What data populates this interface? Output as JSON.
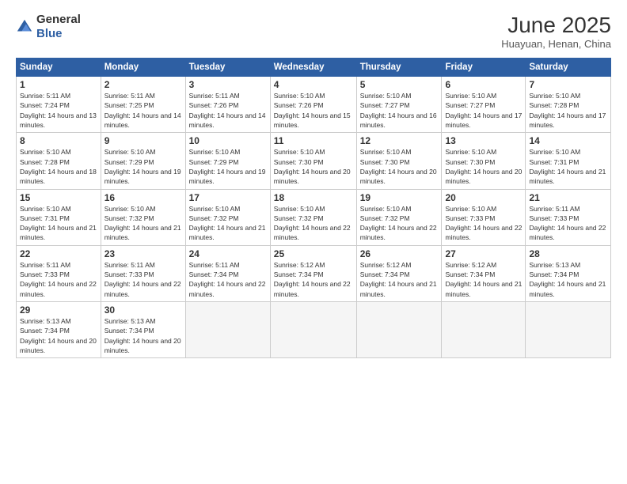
{
  "header": {
    "logo_general": "General",
    "logo_blue": "Blue",
    "title": "June 2025",
    "location": "Huayuan, Henan, China"
  },
  "weekdays": [
    "Sunday",
    "Monday",
    "Tuesday",
    "Wednesday",
    "Thursday",
    "Friday",
    "Saturday"
  ],
  "weeks": [
    [
      {
        "day": "1",
        "sunrise": "5:11 AM",
        "sunset": "7:24 PM",
        "daylight": "14 hours and 13 minutes."
      },
      {
        "day": "2",
        "sunrise": "5:11 AM",
        "sunset": "7:25 PM",
        "daylight": "14 hours and 14 minutes."
      },
      {
        "day": "3",
        "sunrise": "5:11 AM",
        "sunset": "7:26 PM",
        "daylight": "14 hours and 14 minutes."
      },
      {
        "day": "4",
        "sunrise": "5:10 AM",
        "sunset": "7:26 PM",
        "daylight": "14 hours and 15 minutes."
      },
      {
        "day": "5",
        "sunrise": "5:10 AM",
        "sunset": "7:27 PM",
        "daylight": "14 hours and 16 minutes."
      },
      {
        "day": "6",
        "sunrise": "5:10 AM",
        "sunset": "7:27 PM",
        "daylight": "14 hours and 17 minutes."
      },
      {
        "day": "7",
        "sunrise": "5:10 AM",
        "sunset": "7:28 PM",
        "daylight": "14 hours and 17 minutes."
      }
    ],
    [
      {
        "day": "8",
        "sunrise": "5:10 AM",
        "sunset": "7:28 PM",
        "daylight": "14 hours and 18 minutes."
      },
      {
        "day": "9",
        "sunrise": "5:10 AM",
        "sunset": "7:29 PM",
        "daylight": "14 hours and 19 minutes."
      },
      {
        "day": "10",
        "sunrise": "5:10 AM",
        "sunset": "7:29 PM",
        "daylight": "14 hours and 19 minutes."
      },
      {
        "day": "11",
        "sunrise": "5:10 AM",
        "sunset": "7:30 PM",
        "daylight": "14 hours and 20 minutes."
      },
      {
        "day": "12",
        "sunrise": "5:10 AM",
        "sunset": "7:30 PM",
        "daylight": "14 hours and 20 minutes."
      },
      {
        "day": "13",
        "sunrise": "5:10 AM",
        "sunset": "7:30 PM",
        "daylight": "14 hours and 20 minutes."
      },
      {
        "day": "14",
        "sunrise": "5:10 AM",
        "sunset": "7:31 PM",
        "daylight": "14 hours and 21 minutes."
      }
    ],
    [
      {
        "day": "15",
        "sunrise": "5:10 AM",
        "sunset": "7:31 PM",
        "daylight": "14 hours and 21 minutes."
      },
      {
        "day": "16",
        "sunrise": "5:10 AM",
        "sunset": "7:32 PM",
        "daylight": "14 hours and 21 minutes."
      },
      {
        "day": "17",
        "sunrise": "5:10 AM",
        "sunset": "7:32 PM",
        "daylight": "14 hours and 21 minutes."
      },
      {
        "day": "18",
        "sunrise": "5:10 AM",
        "sunset": "7:32 PM",
        "daylight": "14 hours and 22 minutes."
      },
      {
        "day": "19",
        "sunrise": "5:10 AM",
        "sunset": "7:32 PM",
        "daylight": "14 hours and 22 minutes."
      },
      {
        "day": "20",
        "sunrise": "5:10 AM",
        "sunset": "7:33 PM",
        "daylight": "14 hours and 22 minutes."
      },
      {
        "day": "21",
        "sunrise": "5:11 AM",
        "sunset": "7:33 PM",
        "daylight": "14 hours and 22 minutes."
      }
    ],
    [
      {
        "day": "22",
        "sunrise": "5:11 AM",
        "sunset": "7:33 PM",
        "daylight": "14 hours and 22 minutes."
      },
      {
        "day": "23",
        "sunrise": "5:11 AM",
        "sunset": "7:33 PM",
        "daylight": "14 hours and 22 minutes."
      },
      {
        "day": "24",
        "sunrise": "5:11 AM",
        "sunset": "7:34 PM",
        "daylight": "14 hours and 22 minutes."
      },
      {
        "day": "25",
        "sunrise": "5:12 AM",
        "sunset": "7:34 PM",
        "daylight": "14 hours and 22 minutes."
      },
      {
        "day": "26",
        "sunrise": "5:12 AM",
        "sunset": "7:34 PM",
        "daylight": "14 hours and 21 minutes."
      },
      {
        "day": "27",
        "sunrise": "5:12 AM",
        "sunset": "7:34 PM",
        "daylight": "14 hours and 21 minutes."
      },
      {
        "day": "28",
        "sunrise": "5:13 AM",
        "sunset": "7:34 PM",
        "daylight": "14 hours and 21 minutes."
      }
    ],
    [
      {
        "day": "29",
        "sunrise": "5:13 AM",
        "sunset": "7:34 PM",
        "daylight": "14 hours and 20 minutes."
      },
      {
        "day": "30",
        "sunrise": "5:13 AM",
        "sunset": "7:34 PM",
        "daylight": "14 hours and 20 minutes."
      },
      null,
      null,
      null,
      null,
      null
    ]
  ]
}
